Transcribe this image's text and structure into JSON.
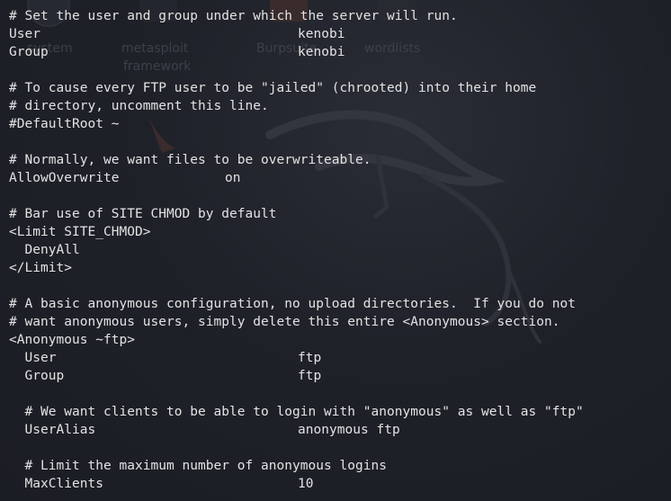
{
  "desktop": {
    "icons": [
      "system",
      "metasploit",
      "Burpsuite",
      "wordlists"
    ],
    "icon_sub": "framework"
  },
  "terminal": {
    "lines": [
      {
        "text": "# Set the user and group under which the server will run.",
        "kind": "comment"
      },
      {
        "key": "User",
        "value": "kenobi"
      },
      {
        "key": "Group",
        "value": "kenobi"
      },
      {
        "text": ""
      },
      {
        "text": "# To cause every FTP user to be \"jailed\" (chrooted) into their home",
        "kind": "comment"
      },
      {
        "text": "# directory, uncomment this line.",
        "kind": "comment"
      },
      {
        "text": "#DefaultRoot ~",
        "kind": "comment"
      },
      {
        "text": ""
      },
      {
        "text": "# Normally, we want files to be overwriteable.",
        "kind": "comment"
      },
      {
        "key": "AllowOverwrite",
        "value": "on",
        "valuePos": "mid"
      },
      {
        "text": ""
      },
      {
        "text": "# Bar use of SITE CHMOD by default",
        "kind": "comment"
      },
      {
        "text": "<Limit SITE_CHMOD>"
      },
      {
        "text": "  DenyAll"
      },
      {
        "text": "</Limit>"
      },
      {
        "text": ""
      },
      {
        "text": "# A basic anonymous configuration, no upload directories.  If you do not",
        "kind": "comment"
      },
      {
        "text": "# want anonymous users, simply delete this entire <Anonymous> section.",
        "kind": "comment"
      },
      {
        "text": "<Anonymous ~ftp>"
      },
      {
        "key": "  User",
        "value": "ftp"
      },
      {
        "key": "  Group",
        "value": "ftp"
      },
      {
        "text": ""
      },
      {
        "text": "  # We want clients to be able to login with \"anonymous\" as well as \"ftp\"",
        "kind": "comment"
      },
      {
        "key": "  UserAlias",
        "value": "anonymous ftp"
      },
      {
        "text": ""
      },
      {
        "text": "  # Limit the maximum number of anonymous logins",
        "kind": "comment"
      },
      {
        "key": "  MaxClients",
        "value": "10"
      }
    ]
  }
}
